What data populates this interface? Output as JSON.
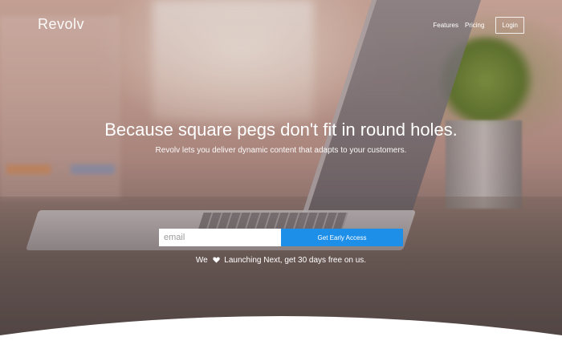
{
  "brand": {
    "logo_text": "Revolv"
  },
  "nav": {
    "features_label": "Features",
    "pricing_label": "Pricing",
    "login_label": "Login"
  },
  "hero": {
    "headline": "Because square pegs don't fit in round holes.",
    "subheadline": "Revolv lets you deliver dynamic content that adapts to your customers."
  },
  "signup": {
    "email_placeholder": "email",
    "email_value": "",
    "cta_label": "Get Early Access"
  },
  "tagline": {
    "prefix": "We",
    "icon": "heart-icon",
    "suffix": "Launching Next, get 30 days free on us."
  },
  "colors": {
    "accent": "#1e8fe8",
    "text_on_hero": "#ffffff",
    "page_background": "#ffffff"
  }
}
